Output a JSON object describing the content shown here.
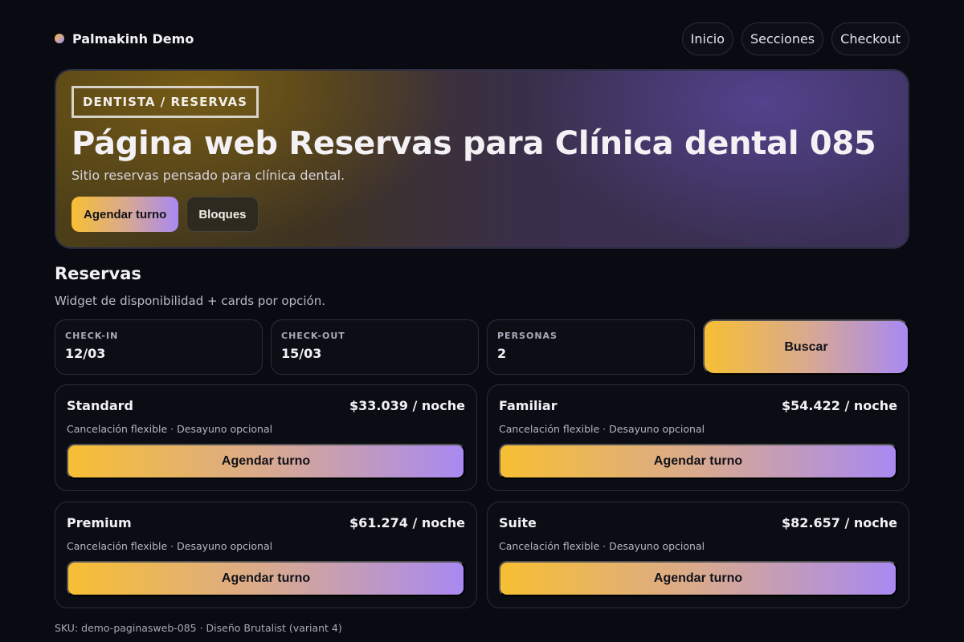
{
  "header": {
    "brand": "Palmakinh Demo",
    "nav": [
      "Inicio",
      "Secciones",
      "Checkout"
    ]
  },
  "hero": {
    "tag": "DENTISTA / RESERVAS",
    "title": "Página web Reservas para Clínica dental 085",
    "subtitle": "Sitio reservas pensado para clínica dental.",
    "primary_label": "Agendar turno",
    "secondary_label": "Bloques"
  },
  "section": {
    "title": "Reservas",
    "subtitle": "Widget de disponibilidad + cards por opción."
  },
  "search": {
    "checkin_label": "CHECK-IN",
    "checkin_value": "12/03",
    "checkout_label": "CHECK-OUT",
    "checkout_value": "15/03",
    "people_label": "PERSONAS",
    "people_value": "2",
    "button_label": "Buscar"
  },
  "cards": [
    {
      "name": "Standard",
      "price": "$33.039 / noche",
      "desc": "Cancelación flexible · Desayuno opcional",
      "button": "Agendar turno"
    },
    {
      "name": "Familiar",
      "price": "$54.422 / noche",
      "desc": "Cancelación flexible · Desayuno opcional",
      "button": "Agendar turno"
    },
    {
      "name": "Premium",
      "price": "$61.274 / noche",
      "desc": "Cancelación flexible · Desayuno opcional",
      "button": "Agendar turno"
    },
    {
      "name": "Suite",
      "price": "$82.657 / noche",
      "desc": "Cancelación flexible · Desayuno opcional",
      "button": "Agendar turno"
    }
  ],
  "footer": "SKU: demo-paginasweb-085 · Diseño Brutalist (variant 4)",
  "colors": {
    "background": "#0a0b12",
    "accent_start": "#f7bf34",
    "accent_end": "#a889f2"
  }
}
